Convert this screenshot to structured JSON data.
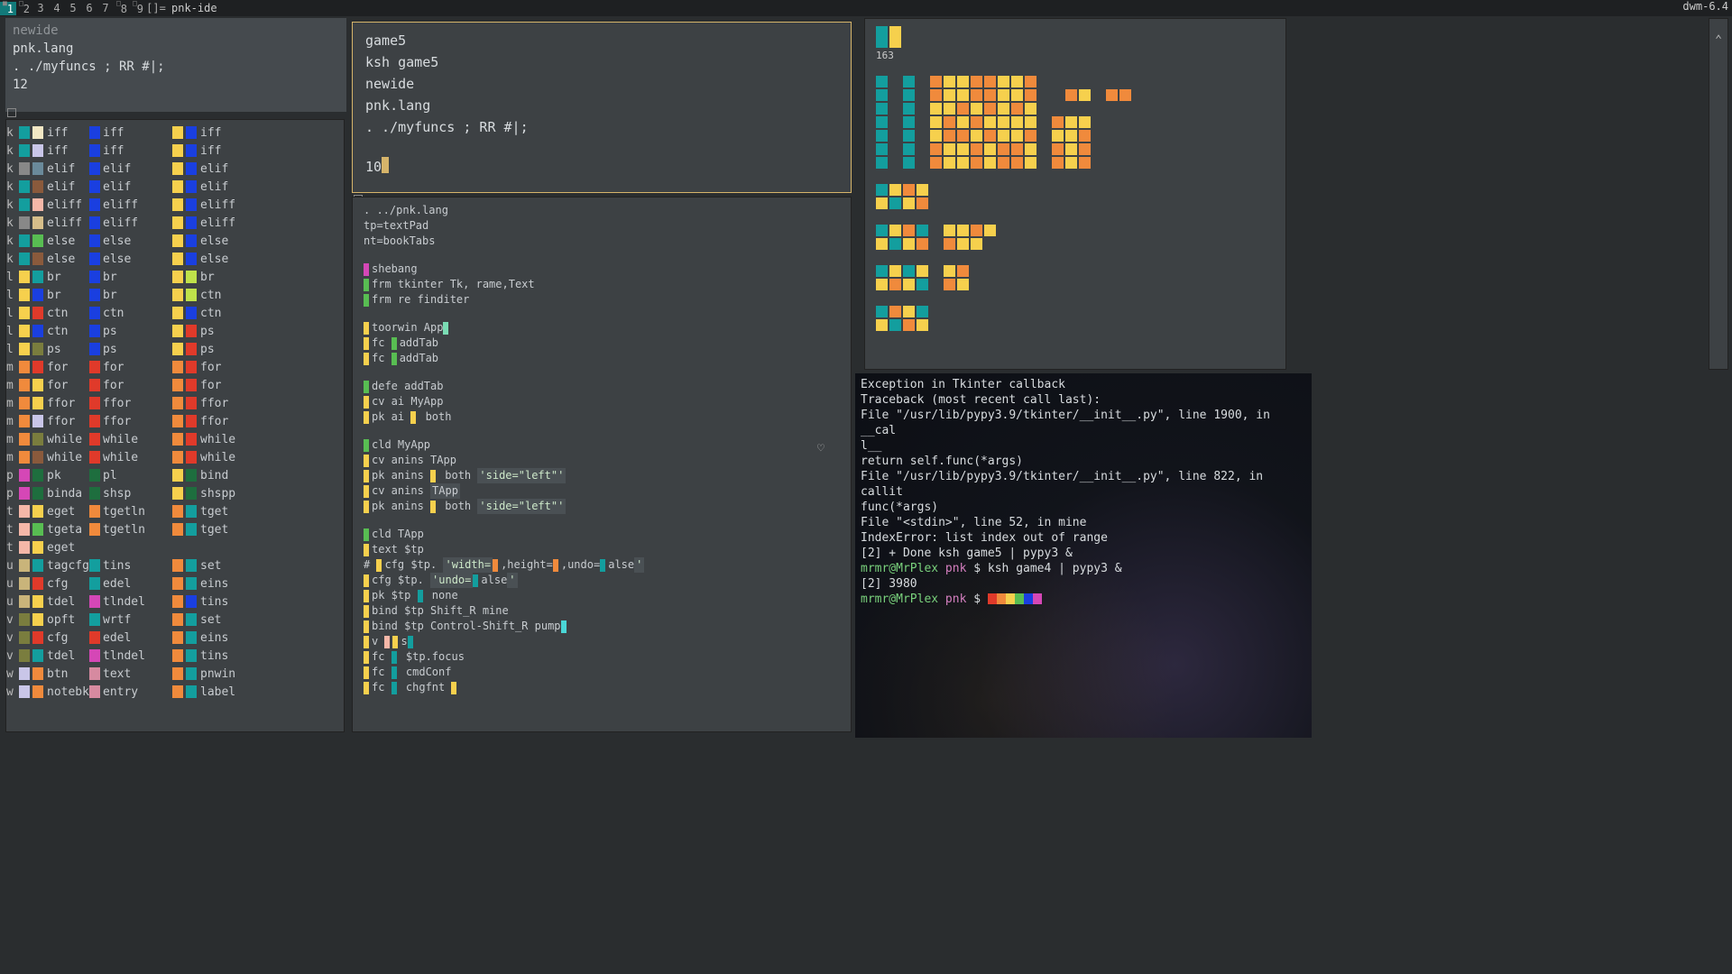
{
  "topbar": {
    "tags": [
      "1",
      "2",
      "3",
      "4",
      "5",
      "6",
      "7",
      "8",
      "9"
    ],
    "layout": "[]=",
    "title": "pnk-ide",
    "wm": "dwm-6.4"
  },
  "header": {
    "lines": [
      "newide",
      "pnk.lang",
      ". ./myfuncs ; RR #|;",
      "12"
    ]
  },
  "symbols": {
    "col0": [
      [
        "k",
        "c-teal",
        "c-cream",
        "iff"
      ],
      [
        "k",
        "c-teal",
        "c-lav",
        "iff"
      ],
      [
        "k",
        "c-gray",
        "c-steel",
        "elif"
      ],
      [
        "k",
        "c-teal",
        "c-brn",
        "elif"
      ],
      [
        "k",
        "c-teal",
        "c-pink",
        "eliff"
      ],
      [
        "k",
        "c-gray",
        "c-sand",
        "eliff"
      ],
      [
        "k",
        "c-teal",
        "c-grn",
        "else"
      ],
      [
        "k",
        "c-teal",
        "c-brn",
        "else"
      ],
      [
        "l",
        "c-yel",
        "c-teal",
        "br"
      ],
      [
        "l",
        "c-yel",
        "c-blue",
        "br"
      ],
      [
        "l",
        "c-yel",
        "c-red",
        "ctn"
      ],
      [
        "l",
        "c-yel",
        "c-blue",
        "ctn"
      ],
      [
        "l",
        "c-yel",
        "c-ol",
        "ps"
      ],
      [
        "m",
        "c-or",
        "c-red",
        "for"
      ],
      [
        "m",
        "c-or",
        "c-yel",
        "for"
      ],
      [
        "m",
        "c-or",
        "c-yel",
        "ffor"
      ],
      [
        "m",
        "c-or",
        "c-lav",
        "ffor"
      ],
      [
        "m",
        "c-or",
        "c-ol",
        "while"
      ],
      [
        "m",
        "c-or",
        "c-brn",
        "while"
      ],
      [
        "p",
        "c-mag",
        "c-dgrn",
        "pk"
      ],
      [
        "p",
        "c-mag",
        "c-dgrn",
        "binda"
      ],
      [
        "t",
        "c-pink",
        "c-yel",
        "eget"
      ],
      [
        "t",
        "c-pink",
        "c-grn",
        "tgeta"
      ],
      [
        "t",
        "c-pink",
        "c-yel",
        "eget"
      ],
      [
        "u",
        "c-tan",
        "c-teal",
        "tagcfg"
      ],
      [
        "u",
        "c-tan",
        "c-red",
        "cfg"
      ],
      [
        "u",
        "c-tan",
        "c-yel",
        "tdel"
      ],
      [
        "v",
        "c-ol",
        "c-yel",
        "opft"
      ],
      [
        "v",
        "c-ol",
        "c-red",
        "cfg"
      ],
      [
        "v",
        "c-ol",
        "c-teal",
        "tdel"
      ],
      [
        "w",
        "c-lav",
        "c-or",
        "btn"
      ],
      [
        "w",
        "c-lav",
        "c-or",
        "notebk"
      ]
    ],
    "col1": [
      [
        "",
        "c-blue",
        "",
        "iff"
      ],
      [
        "",
        "c-blue",
        "",
        "iff"
      ],
      [
        "",
        "c-blue",
        "",
        "elif"
      ],
      [
        "",
        "c-blue",
        "",
        "elif"
      ],
      [
        "",
        "c-blue",
        "",
        "eliff"
      ],
      [
        "",
        "c-blue",
        "",
        "eliff"
      ],
      [
        "",
        "c-blue",
        "",
        "else"
      ],
      [
        "",
        "c-blue",
        "",
        "else"
      ],
      [
        "",
        "c-blue",
        "",
        "br"
      ],
      [
        "",
        "c-blue",
        "",
        "br"
      ],
      [
        "",
        "c-blue",
        "",
        "ctn"
      ],
      [
        "",
        "c-blue",
        "",
        "ps"
      ],
      [
        "",
        "c-blue",
        "",
        "ps"
      ],
      [
        "",
        "c-red",
        "",
        "for"
      ],
      [
        "",
        "c-red",
        "",
        "for"
      ],
      [
        "",
        "c-red",
        "",
        "ffor"
      ],
      [
        "",
        "c-red",
        "",
        "ffor"
      ],
      [
        "",
        "c-red",
        "",
        "while"
      ],
      [
        "",
        "c-red",
        "",
        "while"
      ],
      [
        "",
        "c-dgrn",
        "",
        "pl"
      ],
      [
        "",
        "c-dgrn",
        "",
        "shsp"
      ],
      [
        "",
        "c-or",
        "",
        "tgetln"
      ],
      [
        "",
        "c-or",
        "",
        "tgetln"
      ],
      [
        "",
        "",
        "",
        ""
      ],
      [
        "",
        "c-teal",
        "",
        "tins"
      ],
      [
        "",
        "c-teal",
        "",
        "edel"
      ],
      [
        "",
        "c-mag",
        "",
        "tlndel"
      ],
      [
        "",
        "c-teal",
        "",
        "wrtf"
      ],
      [
        "",
        "c-red",
        "",
        "edel"
      ],
      [
        "",
        "c-mag",
        "",
        "tlndel"
      ],
      [
        "",
        "c-rose",
        "",
        "text"
      ],
      [
        "",
        "c-rose",
        "",
        "entry"
      ]
    ],
    "col2": [
      [
        "",
        "c-yel",
        "c-blue",
        "iff"
      ],
      [
        "",
        "c-yel",
        "c-blue",
        "iff"
      ],
      [
        "",
        "c-yel",
        "c-blue",
        "elif"
      ],
      [
        "",
        "c-yel",
        "c-blue",
        "elif"
      ],
      [
        "",
        "c-yel",
        "c-blue",
        "eliff"
      ],
      [
        "",
        "c-yel",
        "c-blue",
        "eliff"
      ],
      [
        "",
        "c-yel",
        "c-blue",
        "else"
      ],
      [
        "",
        "c-yel",
        "c-blue",
        "else"
      ],
      [
        "",
        "c-yel",
        "c-ylg",
        "br"
      ],
      [
        "",
        "c-yel",
        "c-ylg",
        "ctn"
      ],
      [
        "",
        "c-yel",
        "c-blue",
        "ctn"
      ],
      [
        "",
        "c-yel",
        "c-red",
        "ps"
      ],
      [
        "",
        "c-yel",
        "c-red",
        "ps"
      ],
      [
        "",
        "c-or",
        "c-red",
        "for"
      ],
      [
        "",
        "c-or",
        "c-red",
        "for"
      ],
      [
        "",
        "c-or",
        "c-red",
        "ffor"
      ],
      [
        "",
        "c-or",
        "c-red",
        "ffor"
      ],
      [
        "",
        "c-or",
        "c-red",
        "while"
      ],
      [
        "",
        "c-or",
        "c-red",
        "while"
      ],
      [
        "",
        "c-yel",
        "c-dgrn",
        "bind"
      ],
      [
        "",
        "c-yel",
        "c-dgrn",
        "shspp"
      ],
      [
        "",
        "c-or",
        "c-teal",
        "tget"
      ],
      [
        "",
        "c-or",
        "c-teal",
        "tget"
      ],
      [
        "",
        "",
        "",
        ""
      ],
      [
        "",
        "c-or",
        "c-teal",
        "set"
      ],
      [
        "",
        "c-or",
        "c-teal",
        "eins"
      ],
      [
        "",
        "c-or",
        "c-blue",
        "tins"
      ],
      [
        "",
        "c-or",
        "c-teal",
        "set"
      ],
      [
        "",
        "c-or",
        "c-teal",
        "eins"
      ],
      [
        "",
        "c-or",
        "c-teal",
        "tins"
      ],
      [
        "",
        "c-or",
        "c-teal",
        "pnwin"
      ],
      [
        "",
        "c-or",
        "c-teal",
        "label"
      ]
    ]
  },
  "promptbox": {
    "lines": [
      "game5",
      "ksh game5",
      "newide",
      "pnk.lang",
      ". ./myfuncs ; RR #|;"
    ],
    "input": "10"
  },
  "code": {
    "top": [
      ". ../pnk.lang",
      "tp=textPad",
      "nt=bookTabs"
    ],
    "b1": [
      [
        "c-mag",
        "shebang"
      ],
      [
        "c-grn",
        "frm tkinter Tk, rame,Text"
      ],
      [
        "c-grn",
        "frm re finditer"
      ]
    ],
    "b2": [
      [
        "c-yel",
        "toorwin App",
        "c-mint"
      ],
      [
        "c-yel",
        "fc ",
        "c-grn",
        "addTab"
      ],
      [
        "c-yel",
        "fc ",
        "c-grn",
        "addTab"
      ]
    ],
    "b3": [
      [
        "c-grn",
        "defe addTab"
      ],
      [
        "c-yel",
        "cv ai MyApp"
      ],
      [
        "c-yel",
        "pk ai ",
        "c-yel",
        " both"
      ]
    ],
    "b4": [
      [
        "c-grn",
        "cld MyApp"
      ],
      [
        "c-yel",
        "cv anins TApp"
      ],
      [
        "c-yel",
        "pk anins ",
        "c-yel",
        " both ",
        "q",
        "'side=\"left\"'"
      ],
      [
        "c-yel",
        "cv anins ",
        "hl",
        "TApp"
      ],
      [
        "c-yel",
        "pk anins ",
        "c-yel",
        " both ",
        "q",
        "'side=\"left\"'"
      ]
    ],
    "b5": [
      [
        "c-grn",
        "cld TApp"
      ],
      [
        "c-yel",
        "text $tp"
      ],
      [
        "txt",
        "# ",
        "c-yel",
        "cfg $tp. ",
        "q",
        "'width=",
        "c-or",
        "",
        "txt",
        ",height=",
        "c-or",
        "",
        "txt",
        ",undo=",
        "c-teal",
        "alse",
        "q",
        "'"
      ],
      [
        "c-yel",
        "cfg $tp. ",
        "q",
        "'undo=",
        "c-teal",
        "alse",
        "q",
        "'"
      ],
      [
        "c-yel",
        "pk $tp ",
        "c-teal",
        " none"
      ],
      [
        "c-yel",
        "bind $tp Shift_R mine"
      ],
      [
        "c-yel",
        "bind $tp Control-Shift_R pump",
        "c-cyan",
        ""
      ],
      [
        "c-yel",
        "v ",
        "c-pink",
        "  ",
        "c-yel",
        "s",
        "c-teal",
        ""
      ],
      [
        "c-yel",
        "fc ",
        "c-teal",
        " $tp.focus"
      ],
      [
        "c-yel",
        "fc ",
        "c-teal",
        " cmdConf"
      ],
      [
        "c-yel",
        "fc ",
        "c-teal",
        " chgfnt ",
        "c-yel",
        ""
      ]
    ]
  },
  "mini": {
    "count": "163",
    "topbars": [
      "c-teal",
      "c-yel"
    ],
    "rows": [
      [
        "c-teal",
        "",
        "c-teal",
        "",
        "c-or",
        "c-yel",
        "c-yel",
        "c-or",
        "c-or",
        "c-yel",
        "c-yel",
        "c-or"
      ],
      [
        "c-teal",
        "",
        "c-teal",
        "",
        "c-or",
        "c-yel",
        "c-yel",
        "c-or",
        "c-or",
        "c-yel",
        "c-yel",
        "c-or",
        "",
        "",
        "c-or",
        "c-yel",
        "",
        "c-or",
        "c-or"
      ],
      [
        "c-teal",
        "",
        "c-teal",
        "",
        "c-yel",
        "c-yel",
        "c-or",
        "c-yel",
        "c-or",
        "c-yel",
        "c-or",
        "c-yel"
      ],
      [
        "c-teal",
        "",
        "c-teal",
        "",
        "c-yel",
        "c-or",
        "c-yel",
        "c-or",
        "c-yel",
        "c-yel",
        "c-yel",
        "c-yel",
        "",
        "c-or",
        "c-yel",
        "c-yel"
      ],
      [
        "c-teal",
        "",
        "c-teal",
        "",
        "c-yel",
        "c-or",
        "c-or",
        "c-yel",
        "c-or",
        "c-yel",
        "c-yel",
        "c-or",
        "",
        "c-yel",
        "c-yel",
        "c-or"
      ],
      [
        "c-teal",
        "",
        "c-teal",
        "",
        "c-or",
        "c-yel",
        "c-yel",
        "c-or",
        "c-yel",
        "c-or",
        "c-or",
        "c-yel",
        "",
        "c-or",
        "c-yel",
        "c-or"
      ],
      [
        "c-teal",
        "",
        "c-teal",
        "",
        "c-or",
        "c-yel",
        "c-yel",
        "c-or",
        "c-yel",
        "c-or",
        "c-or",
        "c-yel",
        "",
        "c-or",
        "c-yel",
        "c-or"
      ],
      [
        "",
        "",
        "",
        "",
        "",
        "",
        "",
        "",
        "",
        "",
        "",
        "",
        ""
      ],
      [
        "c-teal",
        "c-yel",
        "c-or",
        "c-yel"
      ],
      [
        "c-yel",
        "c-teal",
        "c-yel",
        "c-or"
      ],
      [
        "",
        "",
        "",
        "",
        ""
      ],
      [
        "c-teal",
        "c-yel",
        "c-or",
        "c-teal",
        "",
        "c-yel",
        "c-yel",
        "c-or",
        "c-yel"
      ],
      [
        "c-yel",
        "c-teal",
        "c-yel",
        "c-or",
        "",
        "c-or",
        "c-yel",
        "c-yel"
      ],
      [
        "",
        "",
        "",
        "",
        ""
      ],
      [
        "c-teal",
        "c-yel",
        "c-teal",
        "c-yel",
        "",
        "c-yel",
        "c-or"
      ],
      [
        "c-yel",
        "c-or",
        "c-yel",
        "c-teal",
        "",
        "c-or",
        "c-yel"
      ],
      [
        "",
        "",
        "",
        "",
        ""
      ],
      [
        "c-teal",
        "c-or",
        "c-yel",
        "c-teal"
      ],
      [
        "c-yel",
        "c-teal",
        "c-or",
        "c-yel"
      ]
    ]
  },
  "terminal": {
    "heart": "♡",
    "lines": [
      "Exception in Tkinter callback",
      "Traceback (most recent call last):",
      "  File \"/usr/lib/pypy3.9/tkinter/__init__.py\", line 1900, in __cal",
      "l__",
      "    return self.func(*args)",
      "  File \"/usr/lib/pypy3.9/tkinter/__init__.py\", line 822, in callit",
      "    func(*args)",
      "  File \"<stdin>\", line 52, in mine",
      "IndexError: list index out of range",
      "",
      "[2] +  Done                    ksh game5 | pypy3 &",
      "mrmr@MrPlex pnk $ ksh game4 | pypy3 &",
      "[2]    3980",
      "mrmr@MrPlex pnk $ "
    ],
    "prompt_user": "mrmr@MrPlex",
    "prompt_path": "pnk"
  }
}
